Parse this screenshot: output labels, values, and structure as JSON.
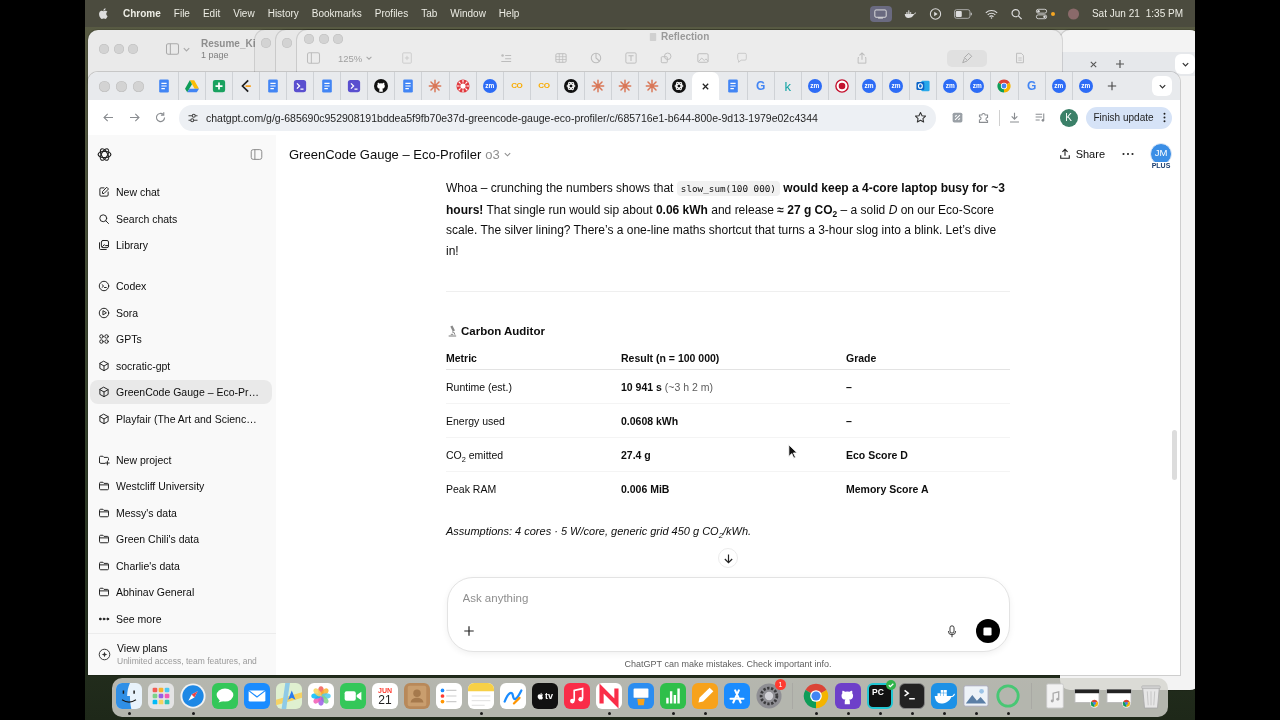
{
  "menu_bar": {
    "app_name": "Chrome",
    "menus": [
      "File",
      "Edit",
      "View",
      "History",
      "Bookmarks",
      "Profiles",
      "Tab",
      "Window",
      "Help"
    ],
    "date": "Sat Jun 21",
    "time": "1:35 PM"
  },
  "background_windows": {
    "document_viewer": {
      "title": "Resume_Ki",
      "subtitle": "1 page"
    },
    "editor": {
      "title": "Reflection",
      "zoom": "125%"
    }
  },
  "browser": {
    "tabs": [
      {
        "kind": "docs",
        "selected": false
      },
      {
        "kind": "drive",
        "selected": false
      },
      {
        "kind": "sheets",
        "selected": false
      },
      {
        "kind": "bracket",
        "selected": false
      },
      {
        "kind": "docs",
        "selected": false
      },
      {
        "kind": "terminal",
        "selected": false
      },
      {
        "kind": "docs",
        "selected": false
      },
      {
        "kind": "terminal",
        "selected": false
      },
      {
        "kind": "github",
        "selected": false
      },
      {
        "kind": "docs",
        "selected": false
      },
      {
        "kind": "starburst",
        "selected": false
      },
      {
        "kind": "wheel",
        "selected": false
      },
      {
        "kind": "zoom",
        "glyph": "zm",
        "selected": false
      },
      {
        "kind": "colab",
        "glyph": "CO",
        "selected": false
      },
      {
        "kind": "colab",
        "glyph": "CO",
        "selected": false
      },
      {
        "kind": "knot",
        "selected": false
      },
      {
        "kind": "starburst",
        "selected": false
      },
      {
        "kind": "starburst",
        "selected": false
      },
      {
        "kind": "starburst",
        "selected": false
      },
      {
        "kind": "knot",
        "selected": false
      },
      {
        "selected": true
      },
      {
        "kind": "docs",
        "selected": false
      },
      {
        "kind": "google",
        "glyph": "G",
        "selected": false
      },
      {
        "kind": "letter",
        "glyph": "k",
        "selected": false
      },
      {
        "kind": "zoom",
        "glyph": "zm",
        "selected": false
      },
      {
        "kind": "record",
        "selected": false
      },
      {
        "kind": "zoom",
        "glyph": "zm",
        "selected": false
      },
      {
        "kind": "zoom",
        "glyph": "zm",
        "selected": false
      },
      {
        "kind": "outlook",
        "selected": false
      },
      {
        "kind": "zoom",
        "glyph": "zm",
        "selected": false
      },
      {
        "kind": "zoom",
        "glyph": "zm",
        "selected": false
      },
      {
        "kind": "chrome",
        "selected": false
      },
      {
        "kind": "google",
        "glyph": "G",
        "selected": false
      },
      {
        "kind": "zoom",
        "glyph": "zm",
        "selected": false
      },
      {
        "kind": "zoom",
        "glyph": "zm",
        "selected": false
      }
    ],
    "address": "chatgpt.com/g/g-685690c952908191bddea5f9fb70e37d-greencode-gauge-eco-profiler/c/685716e1-b644-800e-9d13-1979e02c4344",
    "profile_initial": "K",
    "update_button": "Finish update"
  },
  "chat_app": {
    "sidebar": {
      "groups": [
        {
          "items": [
            {
              "label": "New chat",
              "kind": "new_chat",
              "selected": false
            },
            {
              "label": "Search chats",
              "kind": "search",
              "selected": false
            },
            {
              "label": "Library",
              "kind": "library",
              "selected": false
            }
          ]
        },
        {
          "items": [
            {
              "label": "Codex",
              "kind": "codex",
              "selected": false
            },
            {
              "label": "Sora",
              "kind": "sora",
              "selected": false
            },
            {
              "label": "GPTs",
              "kind": "gpts",
              "selected": false
            },
            {
              "label": "socratic-gpt",
              "kind": "gpt",
              "selected": false
            },
            {
              "label": "GreenCode Gauge – Eco-Pr…",
              "kind": "gpt",
              "selected": true
            },
            {
              "label": "Playfair (The Art and Scienc…",
              "kind": "gpt",
              "selected": false
            }
          ]
        },
        {
          "items": [
            {
              "label": "New project",
              "kind": "new_project",
              "selected": false
            },
            {
              "label": "Westcliff University",
              "kind": "folder",
              "selected": false
            },
            {
              "label": "Messy's data",
              "kind": "folder",
              "selected": false
            },
            {
              "label": "Green Chili's data",
              "kind": "folder",
              "selected": false
            },
            {
              "label": "Charlie's data",
              "kind": "folder",
              "selected": false
            },
            {
              "label": "Abhinav General",
              "kind": "folder",
              "selected": false
            },
            {
              "label": "See more",
              "kind": "more",
              "selected": false
            }
          ]
        }
      ],
      "upgrade": {
        "title": "View plans",
        "subtitle": "Unlimited access, team features, and"
      }
    },
    "header": {
      "title": "GreenCode Gauge – Eco-Profiler",
      "model": "o3",
      "share": "Share",
      "avatar_initials": "JM",
      "avatar_badge": "PLUS"
    },
    "message": {
      "intro": {
        "before": "Whoa – crunching the numbers shows that",
        "code": "slow_sum(100 000)",
        "after": "**would keep a 4-core laptop busy for ~3 hours!** That single run would sip about **0.06 kWh** and release **≈ 27 g CO$_{2}$** – a solid *D* on our Eco-Score scale. The silver lining? There’s a one-line maths shortcut that turns a 3-hour slog into a blink. Let’s dive in!"
      },
      "section_title": "Carbon Auditor",
      "table": {
        "columns": [
          "Metric",
          "Result (n = 100 000)",
          "Grade"
        ],
        "rows": [
          {
            "metric": "Runtime (est.)",
            "result": "10 941 s",
            "result_note": "(~3 h 2 m)",
            "grade": "–"
          },
          {
            "metric": "Energy used",
            "result": "0.0608 kWh",
            "grade": "–"
          },
          {
            "metric": "CO$_{2}$ emitted",
            "result": "27.4 g",
            "grade": "Eco Score D"
          },
          {
            "metric": "Peak RAM",
            "result": "0.006 MiB",
            "grade": "Memory Score A"
          }
        ]
      },
      "note": "Assumptions: 4 cores · 5 W/core, generic grid 450 g CO$_{2}$/kWh."
    },
    "composer": {
      "placeholder": "Ask anything"
    },
    "disclaimer": "ChatGPT can make mistakes. Check important info."
  },
  "dock": {
    "items": [
      {
        "kind": "finder",
        "running": true
      },
      {
        "kind": "launchpad",
        "running": false
      },
      {
        "kind": "safari",
        "running": true
      },
      {
        "kind": "messages",
        "running": false
      },
      {
        "kind": "mail",
        "running": false
      },
      {
        "kind": "maps",
        "running": false
      },
      {
        "kind": "photos",
        "running": false
      },
      {
        "kind": "facetime",
        "running": false
      },
      {
        "kind": "calendar",
        "month": "JUN",
        "day": "21",
        "running": false
      },
      {
        "kind": "contacts",
        "running": false
      },
      {
        "kind": "reminders",
        "running": false
      },
      {
        "kind": "notes",
        "running": true
      },
      {
        "kind": "freeform",
        "running": false
      },
      {
        "kind": "tv",
        "label": "tv",
        "running": false
      },
      {
        "kind": "music",
        "running": false
      },
      {
        "kind": "news",
        "running": true
      },
      {
        "kind": "keynote",
        "running": false
      },
      {
        "kind": "numbers",
        "running": true
      },
      {
        "kind": "pages",
        "running": true
      },
      {
        "kind": "appstore",
        "running": false
      },
      {
        "kind": "settings",
        "badge": "1",
        "running": false
      },
      {
        "kind": "divider"
      },
      {
        "kind": "chrome",
        "running": true
      },
      {
        "kind": "github",
        "running": true
      },
      {
        "kind": "pycharm",
        "label": "PC",
        "running": true
      },
      {
        "kind": "terminal",
        "running": true
      },
      {
        "kind": "docker",
        "running": true
      },
      {
        "kind": "preview",
        "running": true
      },
      {
        "kind": "progress_ring",
        "running": true
      },
      {
        "kind": "divider"
      },
      {
        "kind": "document",
        "running": false
      },
      {
        "kind": "screenshot",
        "running": false
      },
      {
        "kind": "screenshot",
        "running": false
      },
      {
        "kind": "trash",
        "running": false
      }
    ]
  }
}
